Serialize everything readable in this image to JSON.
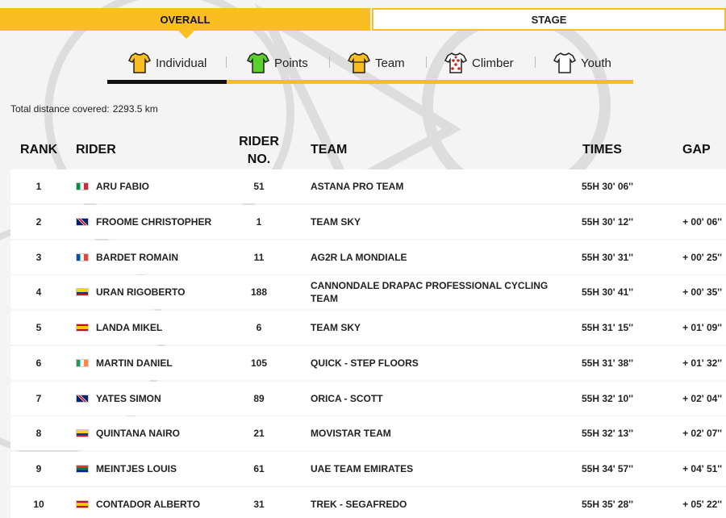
{
  "tabs": {
    "overall": "OVERALL",
    "stage": "STAGE"
  },
  "classification_tabs": [
    {
      "label": "Individual",
      "icon": "yellow-jersey-icon",
      "color": "#fbbe22"
    },
    {
      "label": "Points",
      "icon": "green-jersey-icon",
      "color": "#5bd02c"
    },
    {
      "label": "Team",
      "icon": "team-jersey-icon",
      "color": "#fbbe22"
    },
    {
      "label": "Climber",
      "icon": "polka-dot-jersey-icon",
      "color": "#d32222"
    },
    {
      "label": "Youth",
      "icon": "white-jersey-icon",
      "color": "#ffffff"
    }
  ],
  "summary": {
    "label": "Total distance covered:",
    "value": "2293.5 km"
  },
  "columns": {
    "rank": "RANK",
    "rider": "RIDER",
    "rider_no_1": "RIDER",
    "rider_no_2": "NO.",
    "team": "TEAM",
    "times": "TIMES",
    "gap": "GAP"
  },
  "rows": [
    {
      "rank": "1",
      "flag": "it",
      "rider": "ARU FABIO",
      "rider_no": "51",
      "team": "ASTANA PRO TEAM",
      "time": "55H 30' 06''",
      "gap": ""
    },
    {
      "rank": "2",
      "flag": "gb",
      "rider": "FROOME CHRISTOPHER",
      "rider_no": "1",
      "team": "TEAM SKY",
      "time": "55H 30' 12''",
      "gap": "+ 00' 06''"
    },
    {
      "rank": "3",
      "flag": "fr",
      "rider": "BARDET ROMAIN",
      "rider_no": "11",
      "team": "AG2R LA MONDIALE",
      "time": "55H 30' 31''",
      "gap": "+ 00' 25''"
    },
    {
      "rank": "4",
      "flag": "co",
      "rider": "URAN RIGOBERTO",
      "rider_no": "188",
      "team": "CANNONDALE DRAPAC PROFESSIONAL CYCLING TEAM",
      "time": "55H 30' 41''",
      "gap": "+ 00' 35''"
    },
    {
      "rank": "5",
      "flag": "es",
      "rider": "LANDA MIKEL",
      "rider_no": "6",
      "team": "TEAM SKY",
      "time": "55H 31' 15''",
      "gap": "+ 01' 09''"
    },
    {
      "rank": "6",
      "flag": "ie",
      "rider": "MARTIN DANIEL",
      "rider_no": "105",
      "team": "QUICK - STEP FLOORS",
      "time": "55H 31' 38''",
      "gap": "+ 01' 32''"
    },
    {
      "rank": "7",
      "flag": "gb",
      "rider": "YATES SIMON",
      "rider_no": "89",
      "team": "ORICA - SCOTT",
      "time": "55H 32' 10''",
      "gap": "+ 02' 04''"
    },
    {
      "rank": "8",
      "flag": "co",
      "rider": "QUINTANA NAIRO",
      "rider_no": "21",
      "team": "MOVISTAR TEAM",
      "time": "55H 32' 13''",
      "gap": "+ 02' 07''"
    },
    {
      "rank": "9",
      "flag": "za",
      "rider": "MEINTJES LOUIS",
      "rider_no": "61",
      "team": "UAE TEAM EMIRATES",
      "time": "55H 34' 57''",
      "gap": "+ 04' 51''"
    },
    {
      "rank": "10",
      "flag": "es",
      "rider": "CONTADOR ALBERTO",
      "rider_no": "31",
      "team": "TREK - SEGAFREDO",
      "time": "55H 35' 28''",
      "gap": "+ 05' 22''"
    }
  ]
}
